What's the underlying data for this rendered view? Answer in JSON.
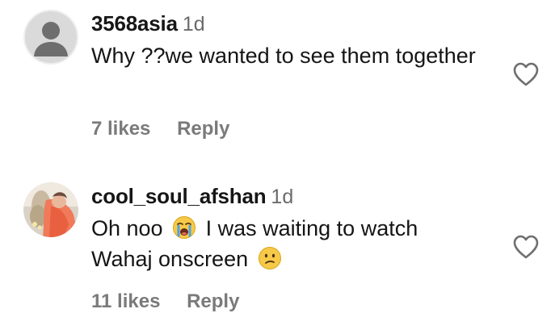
{
  "comments": [
    {
      "username": "3568asia",
      "time": "1d",
      "text": "Why ??we wanted to see them together",
      "likes": "7 likes",
      "reply": "Reply",
      "avatar": "default-user-icon",
      "emojis": []
    },
    {
      "username": "cool_soul_afshan",
      "time": "1d",
      "text_part1": "Oh noo",
      "text_part2": "I was waiting to watch",
      "text_part3": "Wahaj onscreen",
      "likes": "11 likes",
      "reply": "Reply",
      "avatar": "profile-photo",
      "emojis": [
        "loudly-crying-face",
        "confused-face"
      ]
    }
  ],
  "colors": {
    "text": "#151515",
    "meta": "#7a7a7a",
    "timestamp": "#6b6b6b",
    "avatar_bg": "#dcdcdc",
    "avatar_figure": "#ffffff"
  }
}
